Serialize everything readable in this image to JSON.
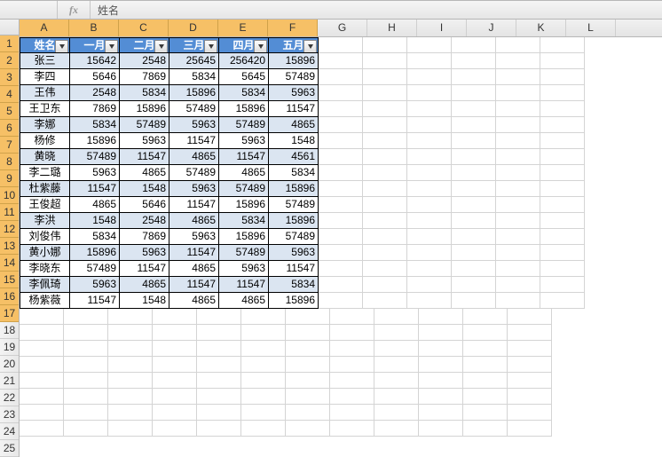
{
  "formula_bar": {
    "label": "",
    "fn": "fx",
    "value": "姓名"
  },
  "columns": [
    "A",
    "B",
    "C",
    "D",
    "E",
    "F",
    "G",
    "H",
    "I",
    "J",
    "K",
    "L"
  ],
  "filter_headers": [
    "姓名",
    "一月",
    "二月",
    "三月",
    "四月",
    "五月"
  ],
  "rows": [
    {
      "name": "张三",
      "v": [
        15642,
        2548,
        25645,
        256420,
        15896
      ]
    },
    {
      "name": "李四",
      "v": [
        5646,
        7869,
        5834,
        5645,
        57489
      ]
    },
    {
      "name": "王伟",
      "v": [
        2548,
        5834,
        15896,
        5834,
        5963
      ]
    },
    {
      "name": "王卫东",
      "v": [
        7869,
        15896,
        57489,
        15896,
        11547
      ]
    },
    {
      "name": "李娜",
      "v": [
        5834,
        57489,
        5963,
        57489,
        4865
      ]
    },
    {
      "name": "杨修",
      "v": [
        15896,
        5963,
        11547,
        5963,
        1548
      ]
    },
    {
      "name": "黄晓",
      "v": [
        57489,
        11547,
        4865,
        11547,
        4561
      ]
    },
    {
      "name": "李二璐",
      "v": [
        5963,
        4865,
        57489,
        4865,
        5834
      ]
    },
    {
      "name": "杜紫藤",
      "v": [
        11547,
        1548,
        5963,
        57489,
        15896
      ]
    },
    {
      "name": "王俊超",
      "v": [
        4865,
        5646,
        11547,
        15896,
        57489
      ]
    },
    {
      "name": "李洪",
      "v": [
        1548,
        2548,
        4865,
        5834,
        15896
      ]
    },
    {
      "name": "刘俊伟",
      "v": [
        5834,
        7869,
        5963,
        15896,
        57489
      ]
    },
    {
      "name": "黄小娜",
      "v": [
        15896,
        5963,
        11547,
        57489,
        5963
      ]
    },
    {
      "name": "李晓东",
      "v": [
        57489,
        11547,
        4865,
        5963,
        11547
      ]
    },
    {
      "name": "李佩琦",
      "v": [
        5963,
        4865,
        11547,
        11547,
        5834
      ]
    },
    {
      "name": "杨紫薇",
      "v": [
        11547,
        1548,
        4865,
        4865,
        15896
      ]
    }
  ],
  "chart_data": {
    "type": "table",
    "title": "",
    "columns": [
      "姓名",
      "一月",
      "二月",
      "三月",
      "四月",
      "五月"
    ],
    "data": [
      [
        "张三",
        15642,
        2548,
        25645,
        256420,
        15896
      ],
      [
        "李四",
        5646,
        7869,
        5834,
        5645,
        57489
      ],
      [
        "王伟",
        2548,
        5834,
        15896,
        5834,
        5963
      ],
      [
        "王卫东",
        7869,
        15896,
        57489,
        15896,
        11547
      ],
      [
        "李娜",
        5834,
        57489,
        5963,
        57489,
        4865
      ],
      [
        "杨修",
        15896,
        5963,
        11547,
        5963,
        1548
      ],
      [
        "黄晓",
        57489,
        11547,
        4865,
        11547,
        4561
      ],
      [
        "李二璐",
        5963,
        4865,
        57489,
        4865,
        5834
      ],
      [
        "杜紫藤",
        11547,
        1548,
        5963,
        57489,
        15896
      ],
      [
        "王俊超",
        4865,
        5646,
        11547,
        15896,
        57489
      ],
      [
        "李洪",
        1548,
        2548,
        4865,
        5834,
        15896
      ],
      [
        "刘俊伟",
        5834,
        7869,
        5963,
        15896,
        57489
      ],
      [
        "黄小娜",
        15896,
        5963,
        11547,
        57489,
        5963
      ],
      [
        "李晓东",
        57489,
        11547,
        4865,
        5963,
        11547
      ],
      [
        "李佩琦",
        5963,
        4865,
        11547,
        11547,
        5834
      ],
      [
        "杨紫薇",
        11547,
        1548,
        4865,
        4865,
        15896
      ]
    ]
  }
}
